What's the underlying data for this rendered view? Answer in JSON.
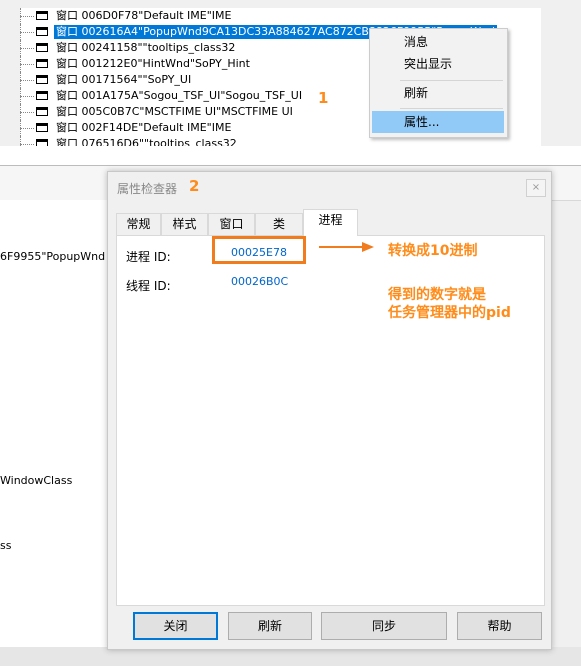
{
  "tree": {
    "rows": [
      {
        "type_label": "窗口",
        "text": "006D0F78\"Default IME\"IME"
      },
      {
        "type_label": "窗口",
        "text": "002616A4\"PopupWnd9CA13DC33A884627AC872CB8826F9955\"PopupWnd"
      },
      {
        "type_label": "窗口",
        "text": "00241158\"\"tooltips_class32"
      },
      {
        "type_label": "窗口",
        "text": "001212E0\"HintWnd\"SoPY_Hint"
      },
      {
        "type_label": "窗口",
        "text": "00171564\"\"SoPY_UI"
      },
      {
        "type_label": "窗口",
        "text": "001A175A\"Sogou_TSF_UI\"Sogou_TSF_UI"
      },
      {
        "type_label": "窗口",
        "text": "005C0B7C\"MSCTFIME UI\"MSCTFIME UI"
      },
      {
        "type_label": "窗口",
        "text": "002F14DE\"Default IME\"IME"
      },
      {
        "type_label": "窗口",
        "text": "076516D6\"\"tooltips_class32"
      }
    ]
  },
  "context_menu": {
    "items": [
      "消息",
      "突出显示",
      "刷新",
      "属性..."
    ]
  },
  "steps": {
    "one": "1",
    "two": "2"
  },
  "background_window": {
    "texts": [
      "6F9955\"PopupWnd",
      "WindowClass",
      "ss"
    ]
  },
  "dialog": {
    "title": "属性检查器",
    "close_glyph": "×",
    "tabs": [
      "常规",
      "样式",
      "窗口",
      "类",
      "进程"
    ],
    "properties": [
      {
        "label": "进程 ID:",
        "value": "00025E78"
      },
      {
        "label": "线程 ID:",
        "value": "00026B0C"
      }
    ],
    "buttons": {
      "close": "关闭",
      "refresh": "刷新",
      "sync": "同步",
      "help": "帮助"
    }
  },
  "annotations": {
    "convert": "转换成10进制",
    "line1": "得到的数字就是",
    "line2": "任务管理器中的pid"
  },
  "colors": {
    "annotation": "#ff8c1a",
    "highlight_box": "#f07c1e",
    "selection": "#0078d7",
    "menu_hover": "#91c9f7",
    "value_link": "#0066cc"
  }
}
